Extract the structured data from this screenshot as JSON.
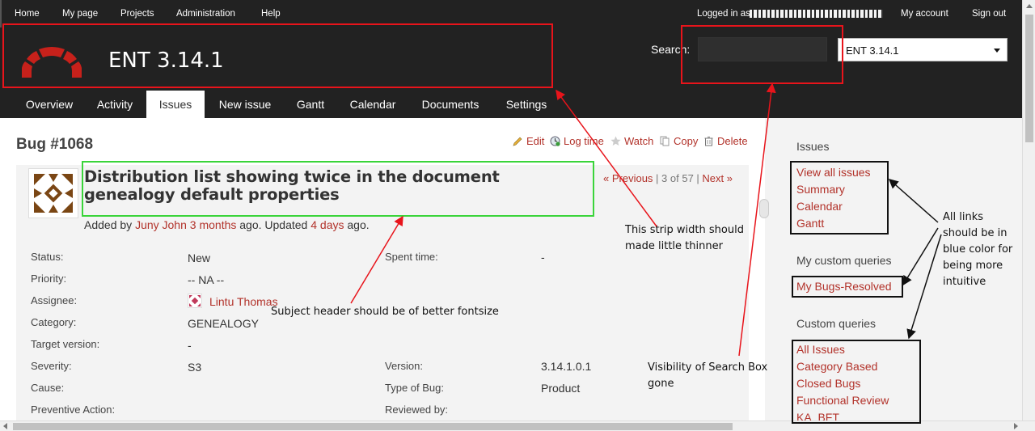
{
  "top_menu": {
    "left": [
      "Home",
      "My page",
      "Projects",
      "Administration",
      "Help"
    ],
    "logged_in": "Logged in as",
    "my_account": "My account",
    "sign_out": "Sign out"
  },
  "header": {
    "project_title": "ENT 3.14.1",
    "search_label": "Search:",
    "project_select_value": "ENT 3.14.1"
  },
  "main_menu": {
    "tabs": [
      "Overview",
      "Activity",
      "Issues",
      "New issue",
      "Gantt",
      "Calendar",
      "Documents",
      "Settings"
    ],
    "selected": "Issues"
  },
  "issue": {
    "title": "Bug #1068",
    "actions": {
      "edit": "Edit",
      "log_time": "Log time",
      "watch": "Watch",
      "copy": "Copy",
      "delete": "Delete"
    },
    "subject": "Distribution list showing twice in the document genealogy default properties",
    "added_by": "Added by",
    "author": "Juny John",
    "created": "3 months",
    "ago_updated": "ago. Updated",
    "updated": "4 days",
    "ago": "ago.",
    "pager": {
      "previous": "« Previous",
      "position": "3 of 57",
      "next": "Next »"
    },
    "attributes_left": [
      {
        "label": "Status:",
        "value": "New"
      },
      {
        "label": "Priority:",
        "value": "-- NA --"
      },
      {
        "label": "Assignee:",
        "value": "Lintu Thomas"
      },
      {
        "label": "Category:",
        "value": "GENEALOGY"
      },
      {
        "label": "Target version:",
        "value": "-"
      },
      {
        "label": "Severity:",
        "value": "S3"
      },
      {
        "label": "Cause:",
        "value": ""
      },
      {
        "label": "Preventive Action:",
        "value": ""
      }
    ],
    "attributes_right": [
      {
        "label": "Spent time:",
        "value": "-"
      },
      {
        "label": "Version:",
        "value": "3.14.1.0.1"
      },
      {
        "label": "Type of Bug:",
        "value": "Product"
      },
      {
        "label": "Reviewed by:",
        "value": ""
      }
    ]
  },
  "sidebar": {
    "issues_heading": "Issues",
    "issues_links": [
      "View all issues",
      "Summary",
      "Calendar",
      "Gantt"
    ],
    "my_queries_heading": "My custom queries",
    "my_queries_links": [
      "My Bugs-Resolved"
    ],
    "custom_queries_heading": "Custom queries",
    "custom_queries_links": [
      "All Issues",
      "Category Based",
      "Closed Bugs",
      "Functional Review",
      "KA_BFT"
    ]
  },
  "annotations": {
    "strip_note": "This strip width should made little thinner",
    "subject_note": "Subject header should be of better fontsize",
    "search_note": "Visibility of Search Box gone",
    "links_note": "All links should be in blue color for being more intuitive"
  },
  "colors": {
    "header_bg": "#222222",
    "link_red": "#b2322a",
    "annotation_red": "#e8141b",
    "annotation_green": "#3ad43a"
  }
}
